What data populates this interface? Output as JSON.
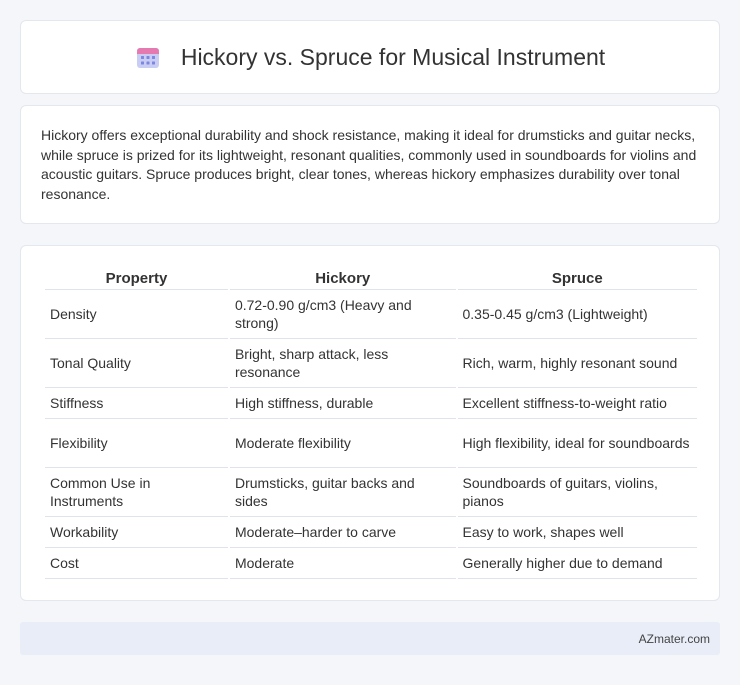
{
  "header": {
    "title": "Hickory vs. Spruce for Musical Instrument",
    "icon": "calendar-icon"
  },
  "summary": {
    "text": "Hickory offers exceptional durability and shock resistance, making it ideal for drumsticks and guitar necks, while spruce is prized for its lightweight, resonant qualities, commonly used in soundboards for violins and acoustic guitars. Spruce produces bright, clear tones, whereas hickory emphasizes durability over tonal resonance."
  },
  "table": {
    "headers": [
      "Property",
      "Hickory",
      "Spruce"
    ],
    "rows": [
      [
        "Density",
        "0.72-0.90 g/cm3 (Heavy and strong)",
        "0.35-0.45 g/cm3 (Lightweight)"
      ],
      [
        "Tonal Quality",
        "Bright, sharp attack, less resonance",
        "Rich, warm, highly resonant sound"
      ],
      [
        "Stiffness",
        "High stiffness, durable",
        "Excellent stiffness-to-weight ratio"
      ],
      [
        "Flexibility",
        "Moderate flexibility",
        "High flexibility, ideal for soundboards"
      ],
      [
        "Common Use in Instruments",
        "Drumsticks, guitar backs and sides",
        "Soundboards of guitars, violins, pianos"
      ],
      [
        "Workability",
        "Moderate–harder to carve",
        "Easy to work, shapes well"
      ],
      [
        "Cost",
        "Moderate",
        "Generally higher due to demand"
      ]
    ]
  },
  "footer": {
    "text": "AZmater.com"
  },
  "colors": {
    "background": "#f4f6fa",
    "card": "#ffffff",
    "footer": "#e8edf7",
    "icon_top": "#e57ab0",
    "icon_body": "#8a94e6"
  }
}
